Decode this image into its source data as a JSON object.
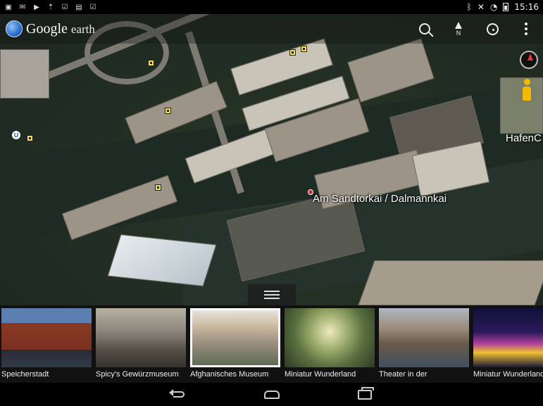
{
  "status_bar": {
    "time": "15:16",
    "left_icons": [
      "image-icon",
      "mail-icon",
      "play-icon",
      "upload-icon",
      "clipboard-check-icon",
      "briefcase-icon",
      "clipboard-check-icon"
    ],
    "right_icons": [
      "bluetooth-icon",
      "mute-icon",
      "wifi-icon",
      "battery-icon"
    ]
  },
  "app": {
    "brand_google": "Google",
    "brand_earth": "earth",
    "search_icon": "search-icon",
    "north_label": "N",
    "location_icon": "my-location-icon",
    "menu_icon": "overflow-menu-icon"
  },
  "map": {
    "pin_label": "Am Sandtorkai / Dalmannkai",
    "edge_label": "HafenC",
    "metro_label": "U",
    "compass_icon": "compass-icon",
    "pegman_icon": "street-view-pegman-icon"
  },
  "tour": {
    "items": [
      {
        "label": "Speicherstadt"
      },
      {
        "label": "Spicy's Gewürzmuseum"
      },
      {
        "label": "Afghanisches Museum",
        "selected": true
      },
      {
        "label": "Miniatur Wunderland"
      },
      {
        "label": "Theater in der"
      },
      {
        "label": "Miniatur Wunderland"
      }
    ]
  },
  "nav_bar": {
    "icons": [
      "back-icon",
      "home-icon",
      "recents-icon"
    ]
  },
  "colors": {
    "poi_marker": "#f4e04a",
    "pin": "#d32f2f",
    "pegman": "#f5b800",
    "compass_needle": "#e53935"
  }
}
